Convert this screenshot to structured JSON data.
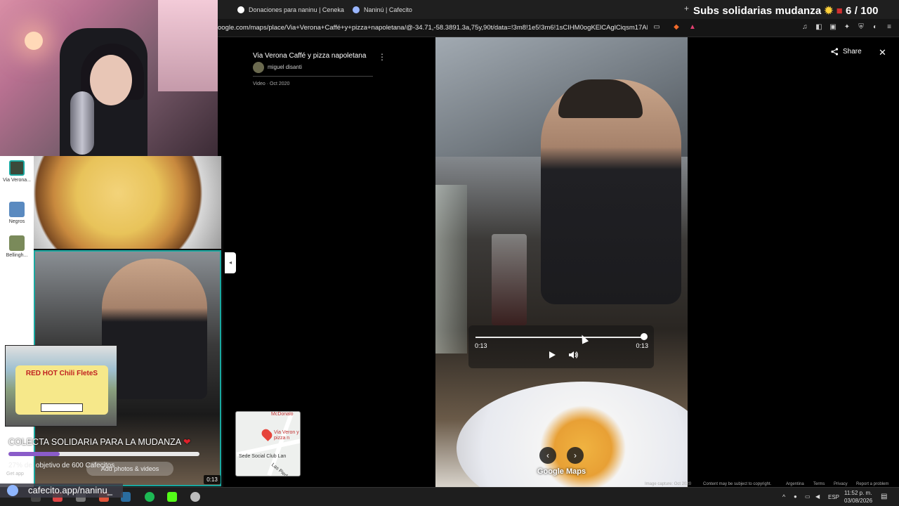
{
  "browser": {
    "tabs": [
      {
        "label": "Donaciones para naninu | Ceneka"
      },
      {
        "label": "Naninú | Cafecito"
      }
    ],
    "new_tab": "+",
    "url": "oogle.com/maps/place/Via+Verona+Caffé+y+pizza+napoletana/@-34.71,-58.3891.3a,75y,90t/data=!3m8!1e5!3m6!1sCIHM0ogKElCAglCiqsm17AE..."
  },
  "overlay": {
    "title": "Subs solidarias mudanza",
    "counter": "6 / 100",
    "donation_title": "COLECTA SOLIDARIA PARA LA MUDANZA",
    "donation_subtitle": "27% del objetivo de 600 Cafecitos",
    "donation_percent": 27,
    "cafecito_url": "cafecito.app/naninu_",
    "truck_sign": "RED HOT Chili FleteS"
  },
  "maps": {
    "place_title": "Via Verona Caffé y pizza napoletana",
    "author": "miguel disanti",
    "video_date": "Video · Oct 2020",
    "rail": [
      {
        "label": "Via Verona..."
      },
      {
        "label": "Negros"
      },
      {
        "label": "Bellingh..."
      }
    ],
    "thumb_duration": "0:13",
    "add_photos": "Add photos & videos",
    "get_app": "Get app",
    "minimap": {
      "label_top": "McDonalo",
      "label_place": "Via Veron y pizza n",
      "label_club": "Sede Social Club Lan",
      "label_street": "Las Pied"
    },
    "share": "Share",
    "logo": "Google Maps",
    "attribution": {
      "capture": "Image capture: Oct 2020",
      "terms_notice": "Content may be subject to copyright.",
      "country": "Argentina",
      "terms": "Terms",
      "privacy": "Privacy",
      "report": "Report a problem"
    }
  },
  "video": {
    "current_time": "0:13",
    "duration": "0:13",
    "progress": 1.0
  },
  "taskbar": {
    "lang": "ESP",
    "time": "11:52 p. m.",
    "date": "03/08/2026"
  }
}
